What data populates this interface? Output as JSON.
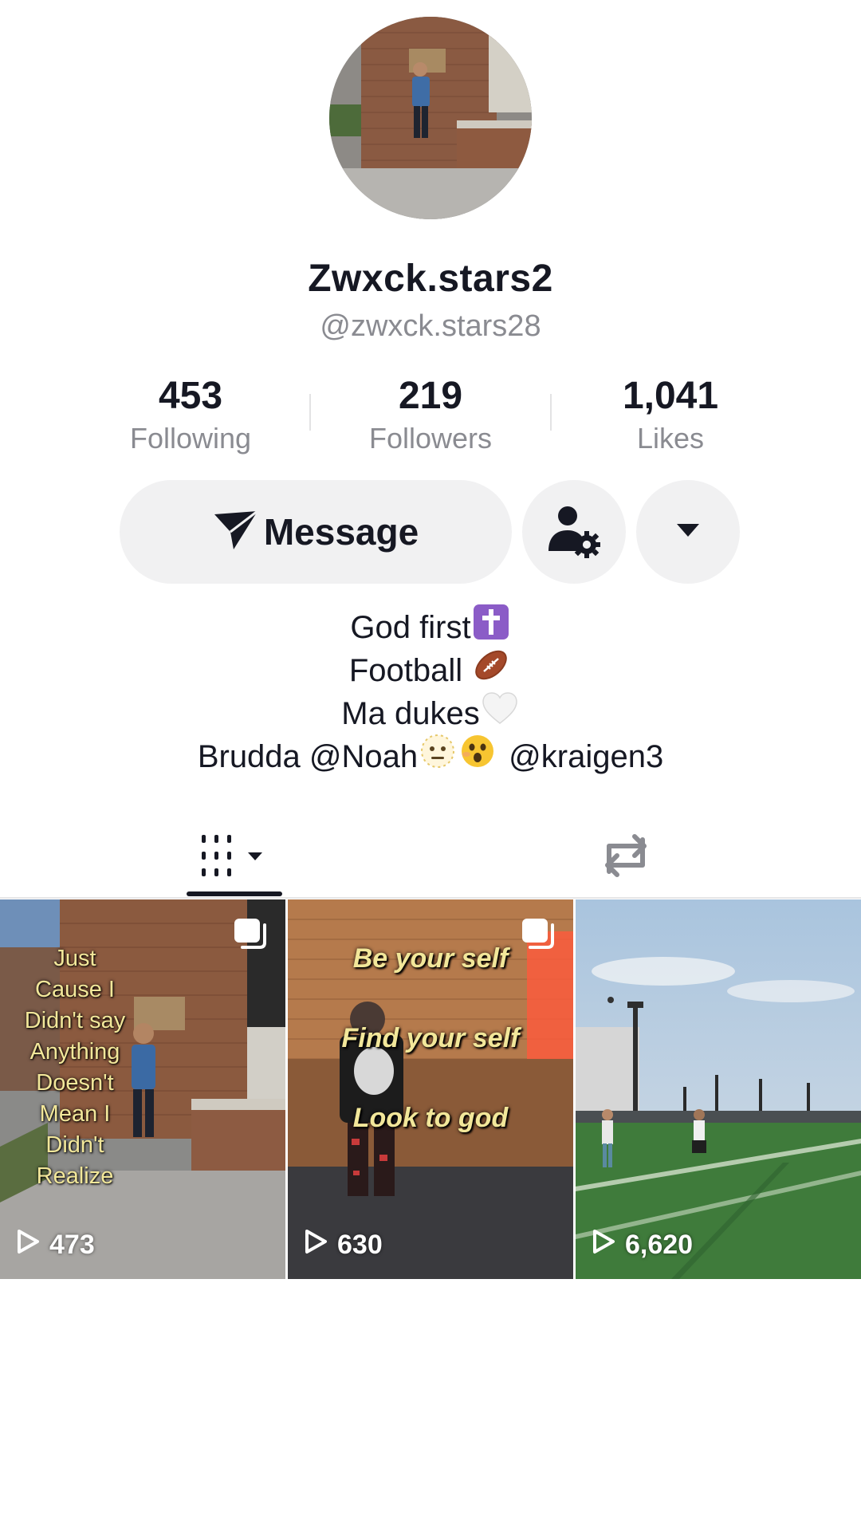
{
  "profile": {
    "display_name": "Zwxck.stars2",
    "handle": "@zwxck.stars28"
  },
  "stats": [
    {
      "value": "453",
      "label": "Following"
    },
    {
      "value": "219",
      "label": "Followers"
    },
    {
      "value": "1,041",
      "label": "Likes"
    }
  ],
  "actions": {
    "message_label": "Message",
    "message_icon": "paper-plane-icon",
    "add_friend_icon": "user-settings-icon",
    "more_icon": "caret-down-icon"
  },
  "bio": {
    "line1": "God first",
    "line1_emoji": "latin-cross-emoji",
    "line2": "Football",
    "line2_emoji": "american-football-emoji",
    "line3": "Ma dukes",
    "line3_emoji": "white-heart-emoji",
    "line4_prefix": "Brudda @Noah",
    "line4_emojis": [
      "dotted-line-face-emoji",
      "astonished-face-emoji"
    ],
    "line4_suffix": "@kraigen3"
  },
  "tabs": [
    {
      "name": "videos",
      "icon": "grid-sort-icon",
      "active": true
    },
    {
      "name": "reposts",
      "icon": "repost-icon",
      "active": false
    }
  ],
  "videos": [
    {
      "views": "473",
      "photo_carousel": true,
      "overlay_lines": [
        "Just",
        "Cause I",
        "Didn't say",
        "Anything",
        "Doesn't",
        "Mean I",
        "Didn't",
        "Realize"
      ]
    },
    {
      "views": "630",
      "photo_carousel": true,
      "overlay_lines": [
        "Be your self",
        "Find your self",
        "Look to god"
      ]
    },
    {
      "views": "6,620",
      "photo_carousel": false,
      "overlay_lines": []
    }
  ],
  "colors": {
    "text": "#161823",
    "secondary_text": "#8a8b91",
    "button_bg": "#f1f1f2",
    "overlay_text": "#f2e79a"
  }
}
